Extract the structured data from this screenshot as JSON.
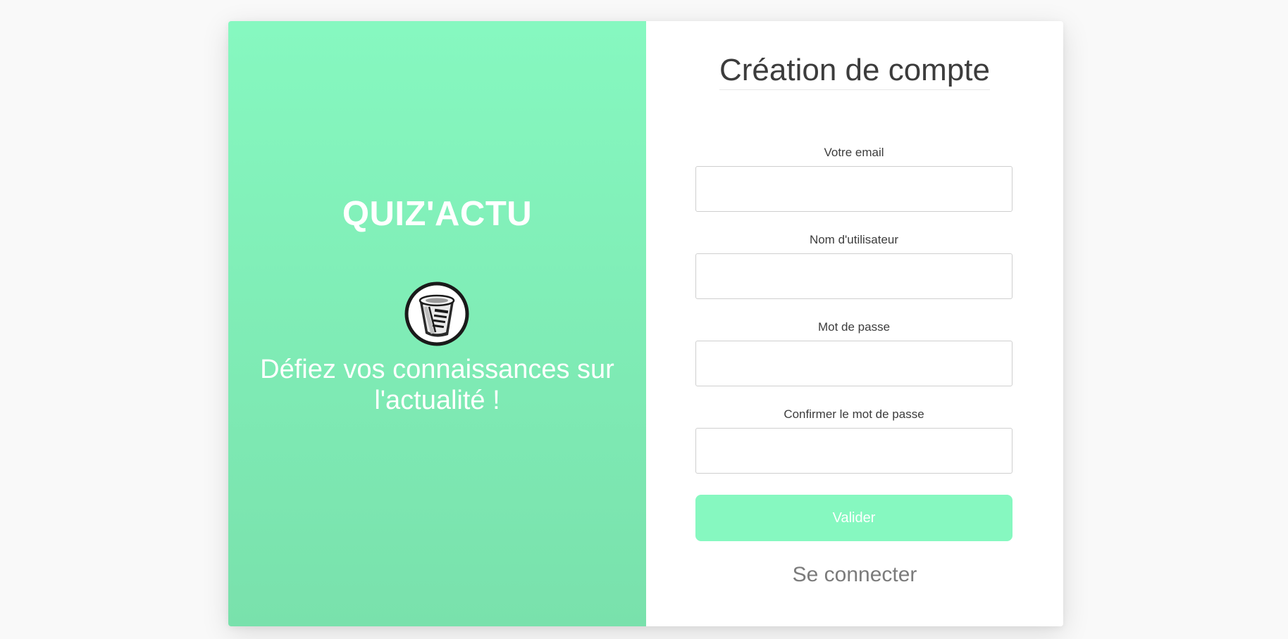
{
  "branding": {
    "name": "QUIZ'ACTU",
    "logo_icon": "newspaper-icon",
    "tagline": "Défiez vos connaissances sur l'actualité !",
    "accent_color": "#86f8c0"
  },
  "signup": {
    "title": "Création de compte",
    "fields": [
      {
        "label": "Votre email",
        "value": "",
        "placeholder": ""
      },
      {
        "label": "Nom d'utilisateur",
        "value": "",
        "placeholder": ""
      },
      {
        "label": "Mot de passe",
        "value": "",
        "placeholder": ""
      },
      {
        "label": "Confirmer le mot de passe",
        "value": "",
        "placeholder": ""
      }
    ],
    "submit_label": "Valider",
    "login_link": "Se connecter"
  }
}
